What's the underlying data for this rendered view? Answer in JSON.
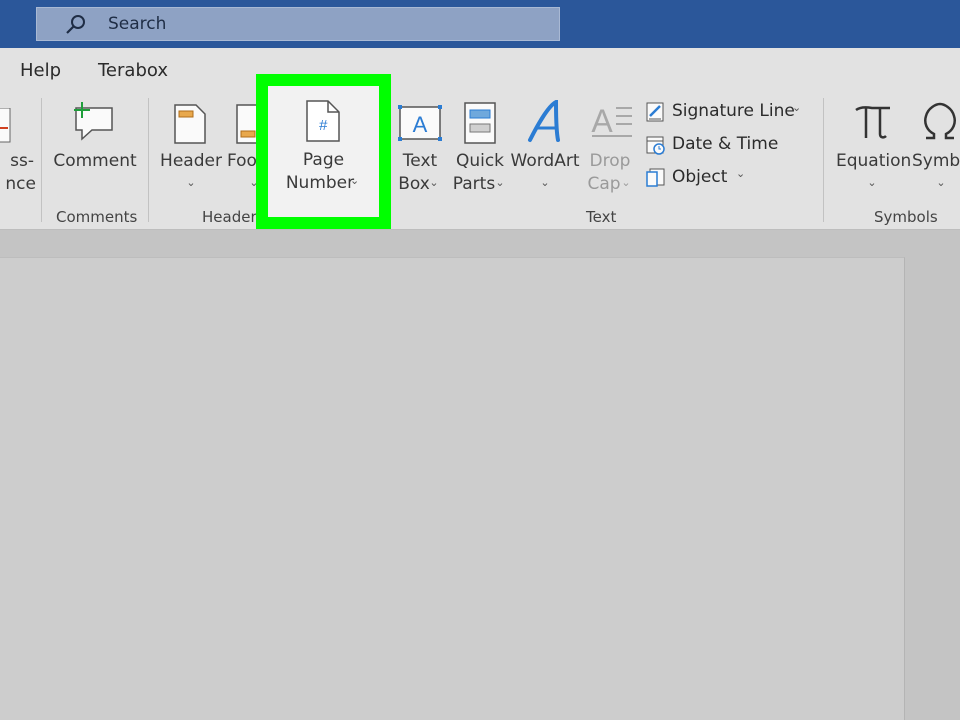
{
  "search": {
    "placeholder": "Search"
  },
  "tabs": [
    {
      "label": "Help"
    },
    {
      "label": "Terabox"
    }
  ],
  "ribbon": {
    "partial_left": {
      "line1": "ss-",
      "line2": "nce"
    },
    "comment": {
      "label": "Comment"
    },
    "header": {
      "label": "Header"
    },
    "footer": {
      "label": "Footer"
    },
    "page_number": {
      "line1": "Page",
      "line2": "Number"
    },
    "text_box": {
      "line1": "Text",
      "line2": "Box"
    },
    "quick_parts": {
      "line1": "Quick",
      "line2": "Parts"
    },
    "wordart": {
      "label": "WordArt"
    },
    "drop_cap": {
      "line1": "Drop",
      "line2": "Cap"
    },
    "signature_line": {
      "label": "Signature Line"
    },
    "date_time": {
      "label": "Date & Time"
    },
    "object": {
      "label": "Object"
    },
    "equation": {
      "label": "Equation"
    },
    "symbol": {
      "label": "Symbol"
    },
    "groups": {
      "comments": "Comments",
      "header_footer": "Header & Footer",
      "text": "Text",
      "symbols": "Symbols"
    }
  },
  "colors": {
    "title_bar": "#2b579a",
    "highlight": "#00ff00",
    "accent_blue": "#2b7cd3"
  }
}
